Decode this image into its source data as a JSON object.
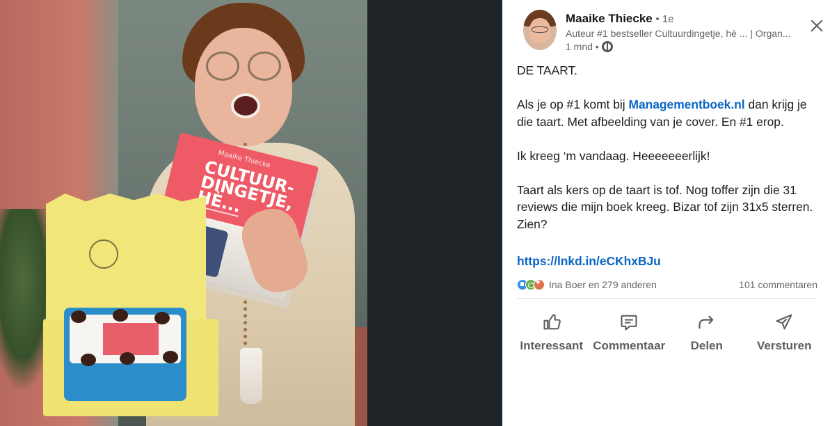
{
  "author": {
    "name": "Maaike Thiecke",
    "degree": "• 1e",
    "headline": "Auteur #1 bestseller Cultuurdingetje, hè ... | Organ...",
    "posted": "1 mnd •"
  },
  "post": {
    "line1": "DE TAART.",
    "p2_before": "Als je op #1 komt bij ",
    "p2_link": "Managementboek.nl",
    "p2_after": " dan krijg je die taart. Met afbeelding van je cover. En #1 erop.",
    "p3": "Ik kreeg ‘m vandaag. Heeeeeeerlijk!",
    "p4": "Taart als kers op de taart is tof. Nog toffer zijn die 31 reviews die mijn boek kreeg. Bizar tof zijn 31x5 sterren. Zien?",
    "url": "https://lnkd.in/eCKhxBJu"
  },
  "image": {
    "book_author": "Maaike Thiecke",
    "book_title_1": "CULTUUR-",
    "book_title_2": "DINGETJE,",
    "book_title_3": "HÈ..."
  },
  "social": {
    "reactions": [
      "like-icon",
      "support-icon",
      "love-icon"
    ],
    "reactors": "Ina Boer en 279 anderen",
    "comments": "101 commentaren"
  },
  "actions": {
    "like": "Interessant",
    "comment": "Commentaar",
    "share": "Delen",
    "send": "Versturen"
  },
  "colors": {
    "link": "#0a66c2",
    "photo_background": "#1d2226"
  }
}
